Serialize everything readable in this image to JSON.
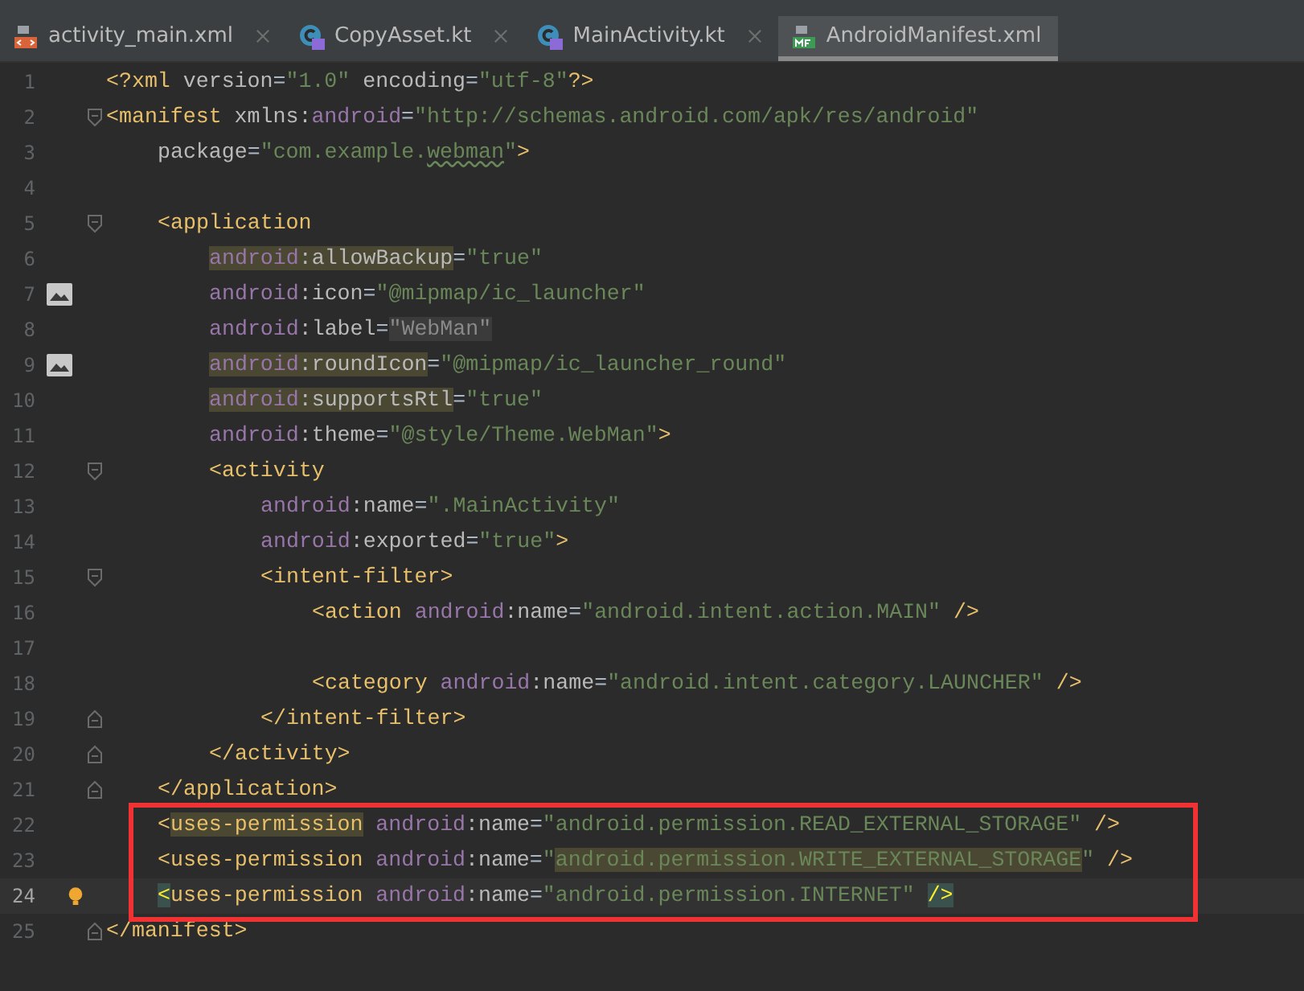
{
  "tabs": [
    {
      "label": "activity_main.xml",
      "kind": "xml",
      "selected": false,
      "closable": true
    },
    {
      "label": "CopyAsset.kt",
      "kind": "kotlin",
      "selected": false,
      "closable": true
    },
    {
      "label": "MainActivity.kt",
      "kind": "kotlin",
      "selected": false,
      "closable": true
    },
    {
      "label": "AndroidManifest.xml",
      "kind": "manifest",
      "selected": true,
      "closable": false
    }
  ],
  "editor": {
    "lines": [
      {
        "number": "1",
        "tokens": [
          {
            "t": "<?xml",
            "kind": "tag"
          },
          {
            "t": " version",
            "kind": "attr"
          },
          {
            "t": "=",
            "kind": "plain"
          },
          {
            "t": "\"1.0\"",
            "kind": "string"
          },
          {
            "t": " encoding",
            "kind": "attr"
          },
          {
            "t": "=",
            "kind": "plain"
          },
          {
            "t": "\"utf-8\"",
            "kind": "string"
          },
          {
            "t": "?>",
            "kind": "tag"
          }
        ]
      },
      {
        "number": "2",
        "fold_start": true,
        "tokens": [
          {
            "t": "<manifest",
            "kind": "tag"
          },
          {
            "t": " xmlns:",
            "kind": "attr"
          },
          {
            "t": "android",
            "kind": "ns"
          },
          {
            "t": "=",
            "kind": "plain"
          },
          {
            "t": "\"http://schemas.android.com/apk/res/android\"",
            "kind": "string"
          }
        ],
        "children": [
          {
            "number": "3",
            "tokens": [
              {
                "t": "package",
                "kind": "attr"
              },
              {
                "t": "=",
                "kind": "plain"
              },
              {
                "t": "\"com.example.",
                "kind": "string"
              },
              {
                "t": "webman",
                "kind": "string",
                "typo": true
              },
              {
                "t": "\"",
                "kind": "string"
              },
              {
                "t": ">",
                "kind": "tag"
              }
            ]
          },
          {
            "number": "4"
          },
          {
            "number": "5",
            "fold_start": true,
            "tokens": [
              {
                "t": "<application",
                "kind": "tag"
              }
            ],
            "children": [
              {
                "number": "6",
                "tokens": [
                  {
                    "t": "android",
                    "kind": "ns",
                    "usage_highlight": true
                  },
                  {
                    "t": ":allowBackup",
                    "kind": "attr",
                    "usage_highlight": true
                  },
                  {
                    "t": "=",
                    "kind": "plain"
                  },
                  {
                    "t": "\"true\"",
                    "kind": "string"
                  }
                ]
              },
              {
                "number": "7",
                "image_preview": true,
                "tokens": [
                  {
                    "t": "android",
                    "kind": "ns"
                  },
                  {
                    "t": ":icon",
                    "kind": "attr"
                  },
                  {
                    "t": "=",
                    "kind": "plain"
                  },
                  {
                    "t": "\"@mipmap/ic_launcher\"",
                    "kind": "string"
                  }
                ]
              },
              {
                "number": "8",
                "tokens": [
                  {
                    "t": "android",
                    "kind": "ns"
                  },
                  {
                    "t": ":label",
                    "kind": "attr"
                  },
                  {
                    "t": "=",
                    "kind": "plain"
                  },
                  {
                    "t": "\"WebMan\"",
                    "kind": "resolved",
                    "label_highlight": true
                  }
                ]
              },
              {
                "number": "9",
                "image_preview": true,
                "tokens": [
                  {
                    "t": "android",
                    "kind": "ns",
                    "usage_highlight": true
                  },
                  {
                    "t": ":roundIcon",
                    "kind": "attr",
                    "usage_highlight": true
                  },
                  {
                    "t": "=",
                    "kind": "plain"
                  },
                  {
                    "t": "\"@mipmap/ic_launcher_round\"",
                    "kind": "string"
                  }
                ]
              },
              {
                "number": "10",
                "tokens": [
                  {
                    "t": "android",
                    "kind": "ns",
                    "usage_highlight": true
                  },
                  {
                    "t": ":supportsRtl",
                    "kind": "attr",
                    "usage_highlight": true
                  },
                  {
                    "t": "=",
                    "kind": "plain"
                  },
                  {
                    "t": "\"true\"",
                    "kind": "string"
                  }
                ]
              },
              {
                "number": "11",
                "tokens": [
                  {
                    "t": "android",
                    "kind": "ns"
                  },
                  {
                    "t": ":theme",
                    "kind": "attr"
                  },
                  {
                    "t": "=",
                    "kind": "plain"
                  },
                  {
                    "t": "\"@style/Theme.WebMan\"",
                    "kind": "string"
                  },
                  {
                    "t": ">",
                    "kind": "tag"
                  }
                ]
              },
              {
                "number": "12",
                "fold_start": true,
                "tokens": [
                  {
                    "t": "<activity",
                    "kind": "tag"
                  }
                ],
                "children": [
                  {
                    "number": "13",
                    "tokens": [
                      {
                        "t": "android",
                        "kind": "ns"
                      },
                      {
                        "t": ":name",
                        "kind": "attr"
                      },
                      {
                        "t": "=",
                        "kind": "plain"
                      },
                      {
                        "t": "\".MainActivity\"",
                        "kind": "string"
                      }
                    ]
                  },
                  {
                    "number": "14",
                    "tokens": [
                      {
                        "t": "android",
                        "kind": "ns"
                      },
                      {
                        "t": ":exported",
                        "kind": "attr"
                      },
                      {
                        "t": "=",
                        "kind": "plain"
                      },
                      {
                        "t": "\"true\"",
                        "kind": "string"
                      },
                      {
                        "t": ">",
                        "kind": "tag"
                      }
                    ]
                  },
                  {
                    "number": "15",
                    "fold_start": true,
                    "tokens": [
                      {
                        "t": "<intent-filter>",
                        "kind": "tag"
                      }
                    ],
                    "children": [
                      {
                        "number": "16",
                        "tokens": [
                          {
                            "t": "<action",
                            "kind": "tag"
                          },
                          {
                            "t": " android",
                            "kind": "ns"
                          },
                          {
                            "t": ":name",
                            "kind": "attr"
                          },
                          {
                            "t": "=",
                            "kind": "plain"
                          },
                          {
                            "t": "\"android.intent.action.MAIN\"",
                            "kind": "string"
                          },
                          {
                            "t": " />",
                            "kind": "tag"
                          }
                        ]
                      },
                      {
                        "number": "17"
                      },
                      {
                        "number": "18",
                        "tokens": [
                          {
                            "t": "<category",
                            "kind": "tag"
                          },
                          {
                            "t": " android",
                            "kind": "ns"
                          },
                          {
                            "t": ":name",
                            "kind": "attr"
                          },
                          {
                            "t": "=",
                            "kind": "plain"
                          },
                          {
                            "t": "\"android.intent.category.LAUNCHER\"",
                            "kind": "string"
                          },
                          {
                            "t": " />",
                            "kind": "tag"
                          }
                        ]
                      }
                    ]
                  },
                  {
                    "number": "19",
                    "fold_end": true,
                    "tokens": [
                      {
                        "t": "</intent-filter>",
                        "kind": "tag"
                      }
                    ]
                  }
                ]
              },
              {
                "number": "20",
                "fold_end": true,
                "tokens": [
                  {
                    "t": "</activity>",
                    "kind": "tag"
                  }
                ]
              }
            ]
          },
          {
            "number": "21",
            "fold_end": true,
            "tokens": [
              {
                "t": "</application>",
                "kind": "tag"
              }
            ]
          },
          {
            "number": "22",
            "boxed": true,
            "tokens": [
              {
                "t": "<",
                "kind": "tag"
              },
              {
                "t": "uses-permission",
                "kind": "tag",
                "usage_highlight": true
              },
              {
                "t": " android",
                "kind": "ns"
              },
              {
                "t": ":name",
                "kind": "attr"
              },
              {
                "t": "=",
                "kind": "plain"
              },
              {
                "t": "\"android.permission.READ_EXTERNAL_STORAGE\"",
                "kind": "string"
              },
              {
                "t": " />",
                "kind": "tag"
              }
            ]
          },
          {
            "number": "23",
            "boxed": true,
            "tokens": [
              {
                "t": "<uses-permission",
                "kind": "tag"
              },
              {
                "t": " android",
                "kind": "ns"
              },
              {
                "t": ":name",
                "kind": "attr"
              },
              {
                "t": "=",
                "kind": "plain"
              },
              {
                "t": "\"",
                "kind": "string"
              },
              {
                "t": "android.permission.WRITE_EXTERNAL_STORAGE",
                "kind": "string",
                "usage_highlight": true
              },
              {
                "t": "\"",
                "kind": "string"
              },
              {
                "t": " />",
                "kind": "tag"
              }
            ]
          },
          {
            "number": "24",
            "boxed": true,
            "current": true,
            "intention_bulb": true,
            "tokens": [
              {
                "t": "<",
                "kind": "tag",
                "brace_match": true
              },
              {
                "t": "uses-permission",
                "kind": "tag"
              },
              {
                "t": " android",
                "kind": "ns"
              },
              {
                "t": ":name",
                "kind": "attr"
              },
              {
                "t": "=",
                "kind": "plain"
              },
              {
                "t": "\"android.permission.INTERNET\" ",
                "kind": "string"
              },
              {
                "t": "/>",
                "kind": "tag",
                "brace_match": true
              }
            ]
          }
        ]
      },
      {
        "number": "25",
        "fold_end": true,
        "tokens": [
          {
            "t": "</manifest>",
            "kind": "tag"
          }
        ]
      }
    ]
  }
}
